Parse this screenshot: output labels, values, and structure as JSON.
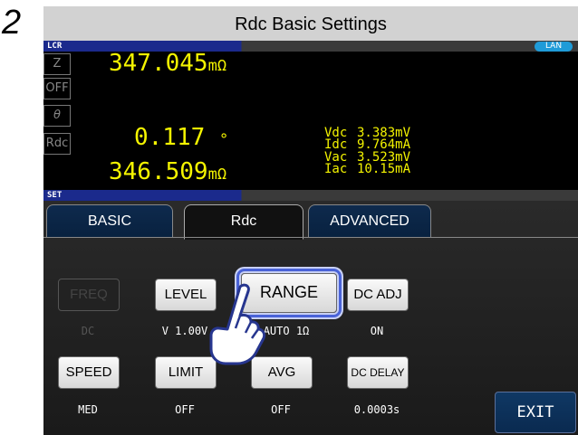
{
  "step_number": "2",
  "page_title": "Rdc Basic Settings",
  "status_strip": {
    "label": "LCR",
    "lan_badge": "LAN"
  },
  "params": [
    {
      "name": "Z",
      "value": "347.045",
      "unit": "mΩ"
    },
    {
      "name": "OFF",
      "value": "",
      "unit": ""
    },
    {
      "name": "θ",
      "value": "0.117",
      "unit": "°"
    },
    {
      "name": "Rdc",
      "value": "346.509",
      "unit": "mΩ"
    }
  ],
  "monitor": [
    {
      "key": "Vdc",
      "value": "3.383mV"
    },
    {
      "key": "Idc",
      "value": "9.764mA"
    },
    {
      "key": "Vac",
      "value": "3.523mV"
    },
    {
      "key": "Iac",
      "value": "10.15mA"
    }
  ],
  "set_strip": {
    "label": "SET"
  },
  "tabs": [
    {
      "label": "BASIC",
      "active": false
    },
    {
      "label": "Rdc",
      "active": true
    },
    {
      "label": "ADVANCED",
      "active": false
    }
  ],
  "row1": [
    {
      "label": "FREQ",
      "value": "DC",
      "enabled": false
    },
    {
      "label": "LEVEL",
      "value": "V  1.00V",
      "enabled": true
    },
    {
      "label": "RANGE",
      "value": "AUTO  1Ω",
      "enabled": true,
      "highlighted": true
    },
    {
      "label": "DC ADJ",
      "value": "ON",
      "enabled": true
    }
  ],
  "row2": [
    {
      "label": "SPEED",
      "value": "MED"
    },
    {
      "label": "LIMIT",
      "value": "OFF"
    },
    {
      "label": "AVG",
      "value": "OFF"
    },
    {
      "label": "DC DELAY",
      "value": "0.0003s"
    }
  ],
  "exit_label": "EXIT",
  "colors": {
    "measure_text": "#f4f400",
    "highlight": "#4a63d8",
    "title_bar": "#d2d2d2"
  }
}
